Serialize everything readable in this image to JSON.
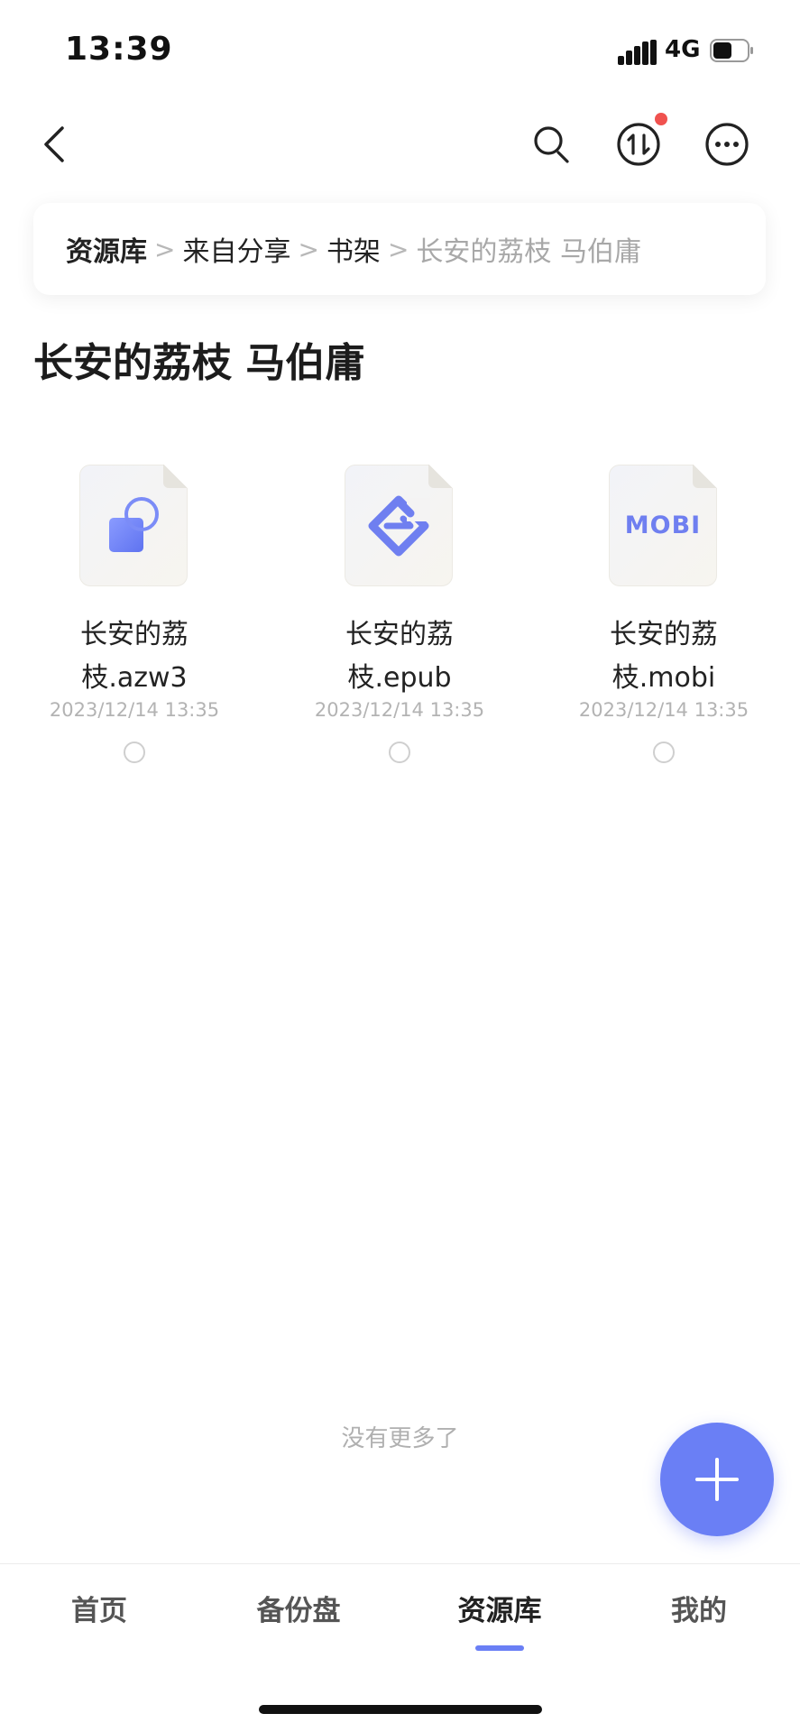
{
  "status_bar": {
    "time": "13:39",
    "network": "4G"
  },
  "nav": {
    "back_icon": "chevron-left-icon",
    "search_icon": "search-icon",
    "transfer_icon": "transfer-icon",
    "more_icon": "more-icon",
    "has_notification": true
  },
  "breadcrumb": [
    {
      "label": "资源库"
    },
    {
      "label": "来自分享"
    },
    {
      "label": "书架"
    },
    {
      "label": "长安的荔枝 马伯庸"
    }
  ],
  "page_title": "长安的荔枝 马伯庸",
  "files": [
    {
      "name_line1": "长安的荔",
      "name_line2": "枝.azw3",
      "date": "2023/12/14 13:35",
      "type": "azw3"
    },
    {
      "name_line1": "长安的荔",
      "name_line2": "枝.epub",
      "date": "2023/12/14 13:35",
      "type": "epub"
    },
    {
      "name_line1": "长安的荔",
      "name_line2": "枝.mobi",
      "date": "2023/12/14 13:35",
      "type": "mobi",
      "thumb_text": "MOBI"
    }
  ],
  "footer_note": "没有更多了",
  "tabs": [
    {
      "label": "首页",
      "active": false
    },
    {
      "label": "备份盘",
      "active": false
    },
    {
      "label": "资源库",
      "active": true
    },
    {
      "label": "我的",
      "active": false
    }
  ],
  "colors": {
    "accent": "#6a7ff5",
    "notification": "#f0524f"
  }
}
